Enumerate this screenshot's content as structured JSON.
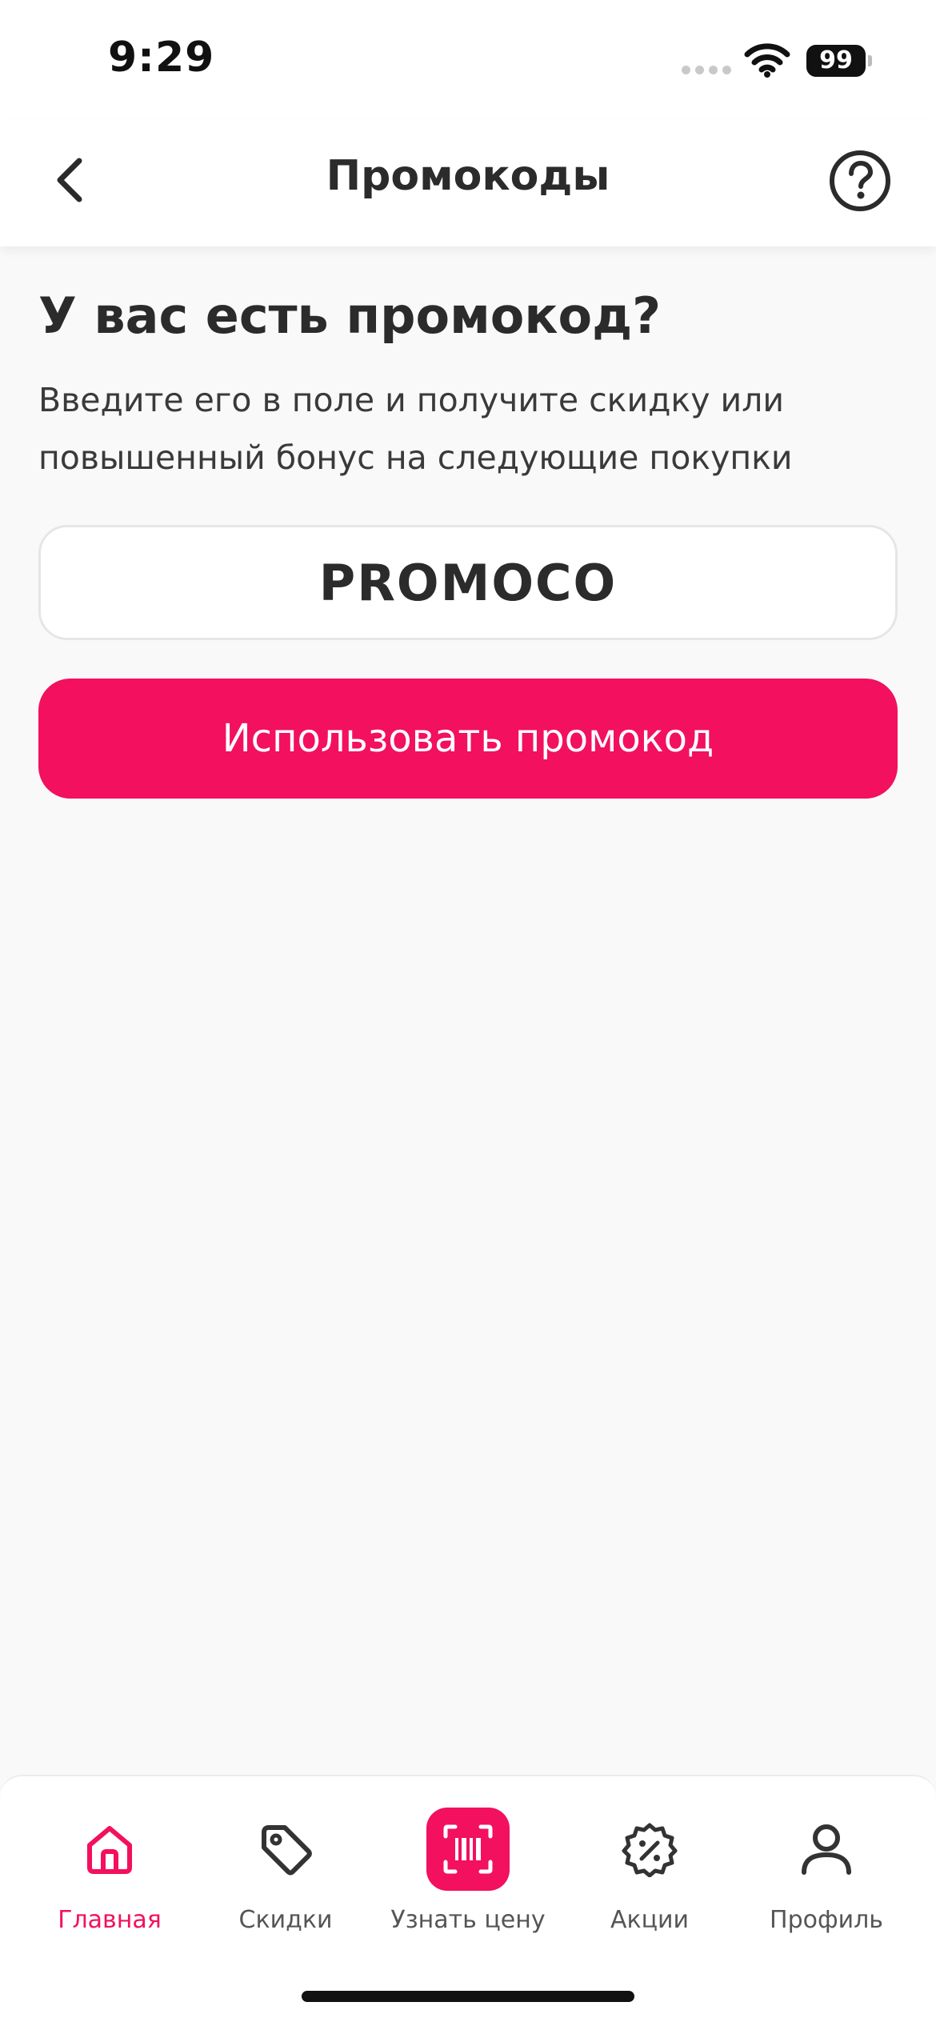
{
  "status_bar": {
    "time": "9:29",
    "battery": "99"
  },
  "header": {
    "title": "Промокоды",
    "back_icon": "chevron-left-icon",
    "help_icon": "question-circle-icon"
  },
  "main": {
    "heading": "У вас есть промокод?",
    "subtitle_line1": "Введите его в поле и получите скидку или",
    "subtitle_line2": "повышенный бонус на следующие покупки",
    "promo_input_value": "PROMOCO",
    "apply_button_label": "Использовать промокод"
  },
  "tabbar": {
    "items": [
      {
        "label": "Главная",
        "icon": "home-icon",
        "active": true
      },
      {
        "label": "Скидки",
        "icon": "tag-icon",
        "active": false
      },
      {
        "label": "Узнать цену",
        "icon": "barcode-scan-icon",
        "active": false
      },
      {
        "label": "Акции",
        "icon": "percent-badge-icon",
        "active": false
      },
      {
        "label": "Профиль",
        "icon": "user-icon",
        "active": false
      }
    ]
  },
  "colors": {
    "accent": "#f2105f",
    "text": "#2b2b2b",
    "background": "#f9f9f9"
  }
}
